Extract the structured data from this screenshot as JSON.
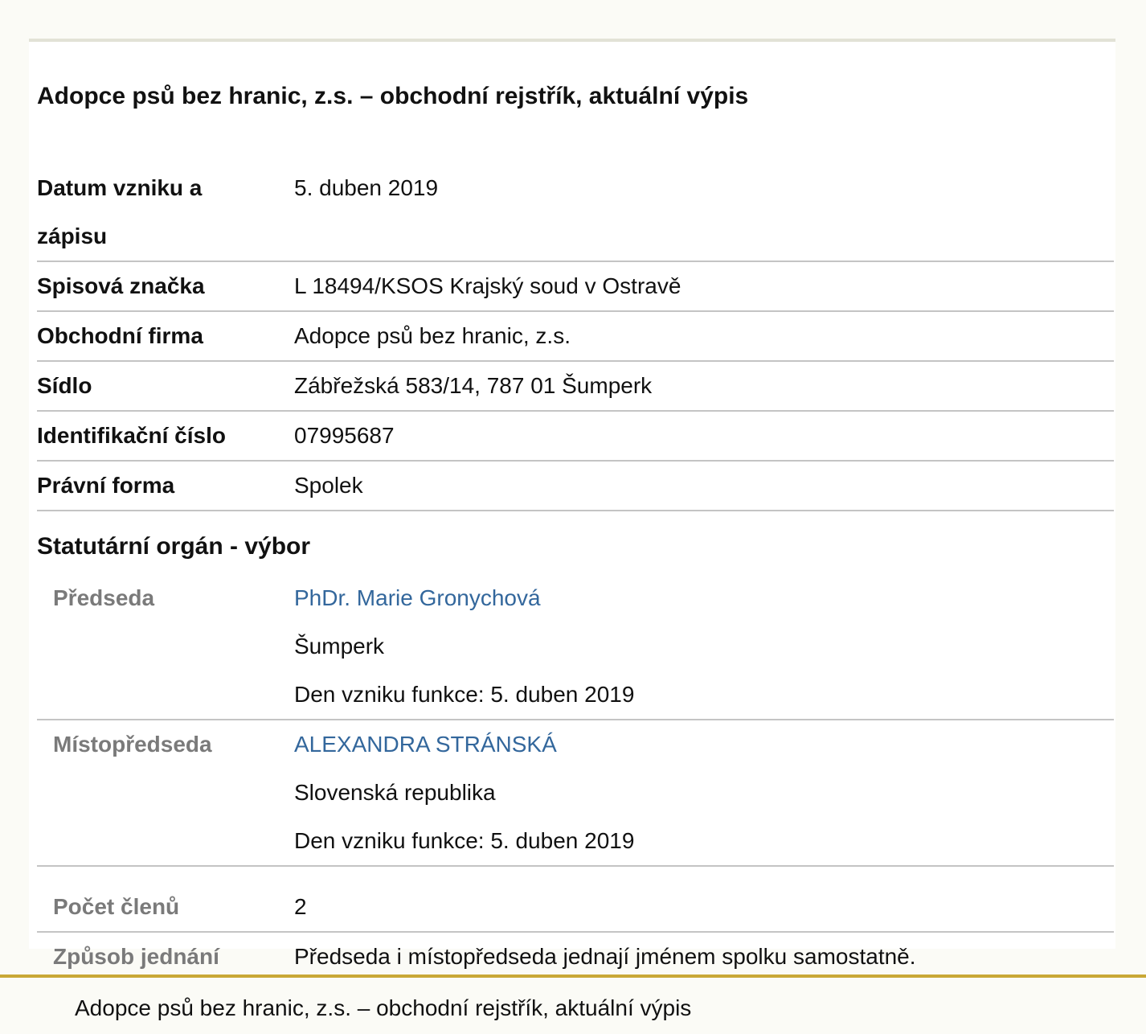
{
  "title": "Adopce psů bez hranic, z.s. – obchodní rejstřík, aktuální výpis",
  "fields": [
    {
      "label": "Datum vzniku a zápisu",
      "value": "5. duben 2019"
    },
    {
      "label": "Spisová značka",
      "value": "L 18494/KSOS Krajský soud v Ostravě"
    },
    {
      "label": "Obchodní firma",
      "value": "Adopce psů bez hranic, z.s."
    },
    {
      "label": "Sídlo",
      "value": "Zábřežská 583/14, 787 01 Šumperk"
    },
    {
      "label": "Identifikační číslo",
      "value": "07995687"
    },
    {
      "label": "Právní forma",
      "value": "Spolek"
    }
  ],
  "statutory": {
    "title": "Statutární orgán - výbor",
    "members": [
      {
        "role": "Předseda",
        "name": "PhDr. Marie Gronychová",
        "location": "Šumperk",
        "since": "Den vzniku funkce: 5. duben 2019"
      },
      {
        "role": "Místopředseda",
        "name": "ALEXANDRA STRÁNSKÁ",
        "location": "Slovenská republika",
        "since": "Den vzniku funkce: 5. duben 2019"
      }
    ],
    "count_label": "Počet členů",
    "count_value": "2",
    "conduct_label": "Způsob jednání",
    "conduct_value": "Předseda i místopředseda jednají jménem spolku samostatně."
  },
  "footer": {
    "text": "Adopce psů bez hranic, z.s. – obchodní rejstřík, aktuální výpis"
  },
  "colors": {
    "link": "#33679c",
    "footer_accent": "#c9a836",
    "sub_label": "#7a7a7a"
  }
}
